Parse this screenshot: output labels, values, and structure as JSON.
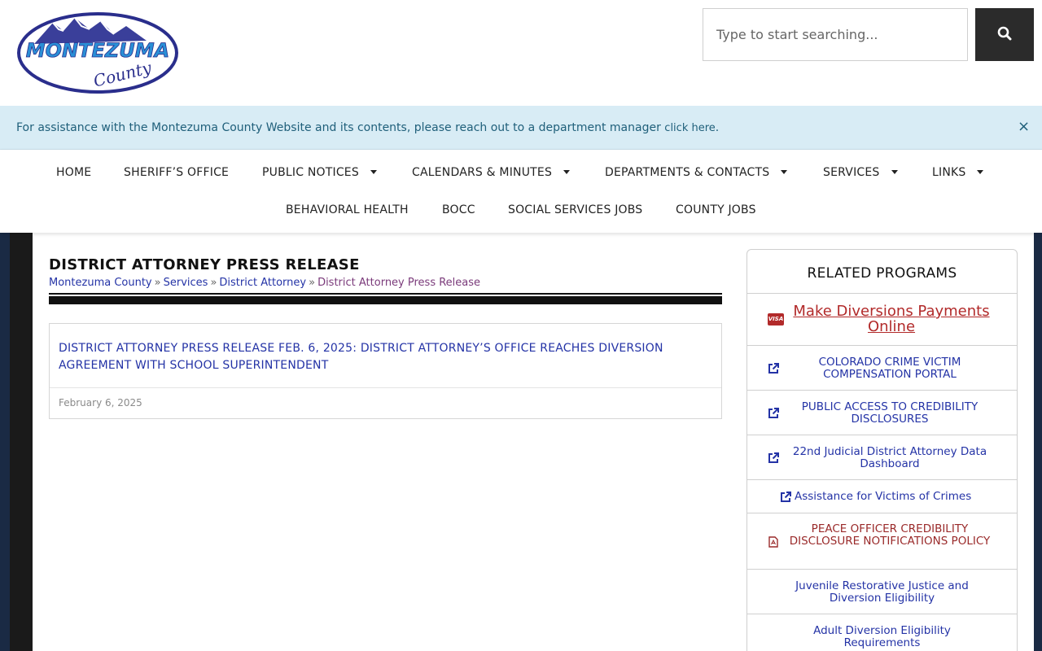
{
  "logo": {
    "line1": "MONTEZUMA",
    "line2": "County"
  },
  "search": {
    "placeholder": "Type to start searching..."
  },
  "notice": {
    "text": "For assistance with the Montezuma County Website and its contents, please reach out to a department manager ",
    "link": "click here",
    "after": ".",
    "close": "×"
  },
  "nav": {
    "row1": [
      {
        "label": "HOME"
      },
      {
        "label": "SHERIFF’S OFFICE"
      },
      {
        "label": "PUBLIC NOTICES"
      },
      {
        "label": "CALENDARS & MINUTES"
      },
      {
        "label": "DEPARTMENTS & CONTACTS"
      },
      {
        "label": "SERVICES"
      },
      {
        "label": "LINKS"
      }
    ],
    "row2": [
      {
        "label": "BEHAVIORAL HEALTH"
      },
      {
        "label": "BOCC"
      },
      {
        "label": "SOCIAL SERVICES JOBS"
      },
      {
        "label": "COUNTY JOBS"
      }
    ]
  },
  "page": {
    "title": "DISTRICT ATTORNEY PRESS RELEASE",
    "breadcrumb": [
      "Montezuma County",
      "Services",
      "District Attorney",
      "District Attorney Press Release"
    ],
    "breadcrumb_sep": "»"
  },
  "posts": [
    {
      "title": "DISTRICT ATTORNEY PRESS RELEASE FEB. 6, 2025: DISTRICT ATTORNEY’S OFFICE REACHES DIVERSION AGREEMENT WITH SCHOOL SUPERINTENDENT",
      "date": "February 6, 2025"
    }
  ],
  "sidebar": {
    "title": "RELATED PROGRAMS",
    "items": [
      {
        "label": "Make Diversions Payments Online",
        "icon": "visa-card-icon",
        "badge": "VISA"
      },
      {
        "label": "COLORADO CRIME VICTIM COMPENSATION PORTAL",
        "icon": "external-link-icon"
      },
      {
        "label": "PUBLIC ACCESS TO CREDIBILITY DISCLOSURES",
        "icon": "external-link-icon"
      },
      {
        "label": "22nd Judicial District Attorney Data Dashboard",
        "icon": "external-link-icon"
      },
      {
        "label": "Assistance for Victims of Crimes",
        "icon": "external-link-icon"
      },
      {
        "label": "PEACE OFFICER CREDIBILITY DISCLOSURE NOTIFICATIONS POLICY",
        "icon": "pdf-file-icon"
      },
      {
        "label": "Juvenile Restorative Justice and Diversion Eligibility"
      },
      {
        "label": "Adult Diversion Eligibility Requirements"
      }
    ]
  },
  "colors": {
    "link_blue": "#2433a6",
    "notice_bg": "#d8ecf5",
    "dark": "#2b2b2b",
    "pdf_red": "#9a2a2a"
  }
}
